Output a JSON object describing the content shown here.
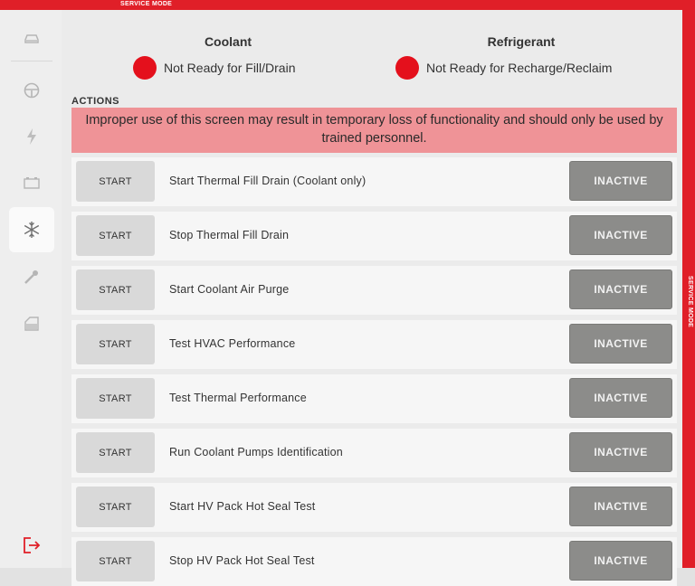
{
  "service_mode_label": "SERVICE MODE",
  "coolant": {
    "title": "Coolant",
    "status": "Not Ready for Fill/Drain",
    "status_color": "#e4101c"
  },
  "refrigerant": {
    "title": "Refrigerant",
    "status": "Not Ready for Recharge/Reclaim",
    "status_color": "#e4101c"
  },
  "actions_label": "ACTIONS",
  "warning": "Improper use of this screen may result in temporary loss of functionality and should only be used by trained personnel.",
  "sidebar": {
    "items": [
      {
        "icon": "car-icon",
        "active": false
      },
      {
        "icon": "steering-wheel-icon",
        "active": false
      },
      {
        "icon": "lightning-icon",
        "active": false
      },
      {
        "icon": "battery-icon",
        "active": false
      },
      {
        "icon": "snowflake-icon",
        "active": true
      },
      {
        "icon": "wrench-icon",
        "active": false
      },
      {
        "icon": "door-icon",
        "active": false
      }
    ],
    "exit_icon": "exit-icon",
    "accent": "#e01f28"
  },
  "rows": [
    {
      "button": "START",
      "label": "Start Thermal Fill Drain (Coolant only)",
      "status": "INACTIVE"
    },
    {
      "button": "START",
      "label": "Stop Thermal Fill Drain",
      "status": "INACTIVE"
    },
    {
      "button": "START",
      "label": "Start Coolant Air Purge",
      "status": "INACTIVE"
    },
    {
      "button": "START",
      "label": "Test HVAC Performance",
      "status": "INACTIVE"
    },
    {
      "button": "START",
      "label": "Test Thermal Performance",
      "status": "INACTIVE"
    },
    {
      "button": "START",
      "label": "Run Coolant Pumps Identification",
      "status": "INACTIVE"
    },
    {
      "button": "START",
      "label": "Start HV Pack Hot Seal Test",
      "status": "INACTIVE"
    },
    {
      "button": "START",
      "label": "Stop HV Pack Hot Seal Test",
      "status": "INACTIVE"
    }
  ]
}
